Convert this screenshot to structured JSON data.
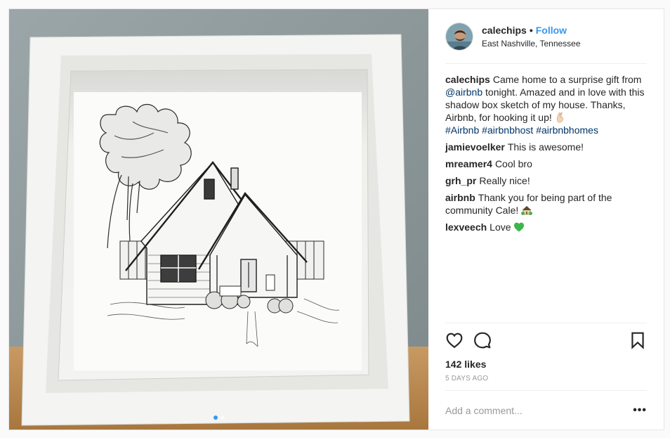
{
  "post": {
    "author": "calechips",
    "separator": "•",
    "follow_label": "Follow",
    "location": "East Nashville, Tennessee",
    "caption": {
      "username": "calechips",
      "text_1": "Came home to a surprise gift from ",
      "mention": "@airbnb",
      "text_2": " tonight. Amazed and in love with this shadow box sketch of my house. Thanks, Airbnb, for hooking it up! ",
      "hashtags": [
        "#Airbnb",
        "#airbnbhost",
        "#airbnbhomes"
      ]
    },
    "comments": [
      {
        "username": "jamievoelker",
        "text": "This is awesome!"
      },
      {
        "username": "mreamer4",
        "text": "Cool bro"
      },
      {
        "username": "grh_pr",
        "text": "Really nice!"
      },
      {
        "username": "airbnb",
        "text": "Thank you for being part of the community Cale! "
      },
      {
        "username": "lexveech",
        "text": "Love "
      }
    ],
    "likes": "142 likes",
    "time": "5 DAYS AGO",
    "add_comment_placeholder": "Add a comment...",
    "more_label": "•••",
    "carousel": {
      "count": 2,
      "active_index": 0
    }
  },
  "icons": {
    "like": "heart-icon",
    "comment": "comment-icon",
    "save": "bookmark-icon",
    "caption_emoji": "crossed-fingers-emoji",
    "airbnb_emoji": "house-with-garden-emoji",
    "lexveech_emoji": "green-heart-emoji"
  },
  "colors": {
    "link": "#003569",
    "follow": "#3897f0",
    "muted": "#999999",
    "text": "#262626"
  }
}
